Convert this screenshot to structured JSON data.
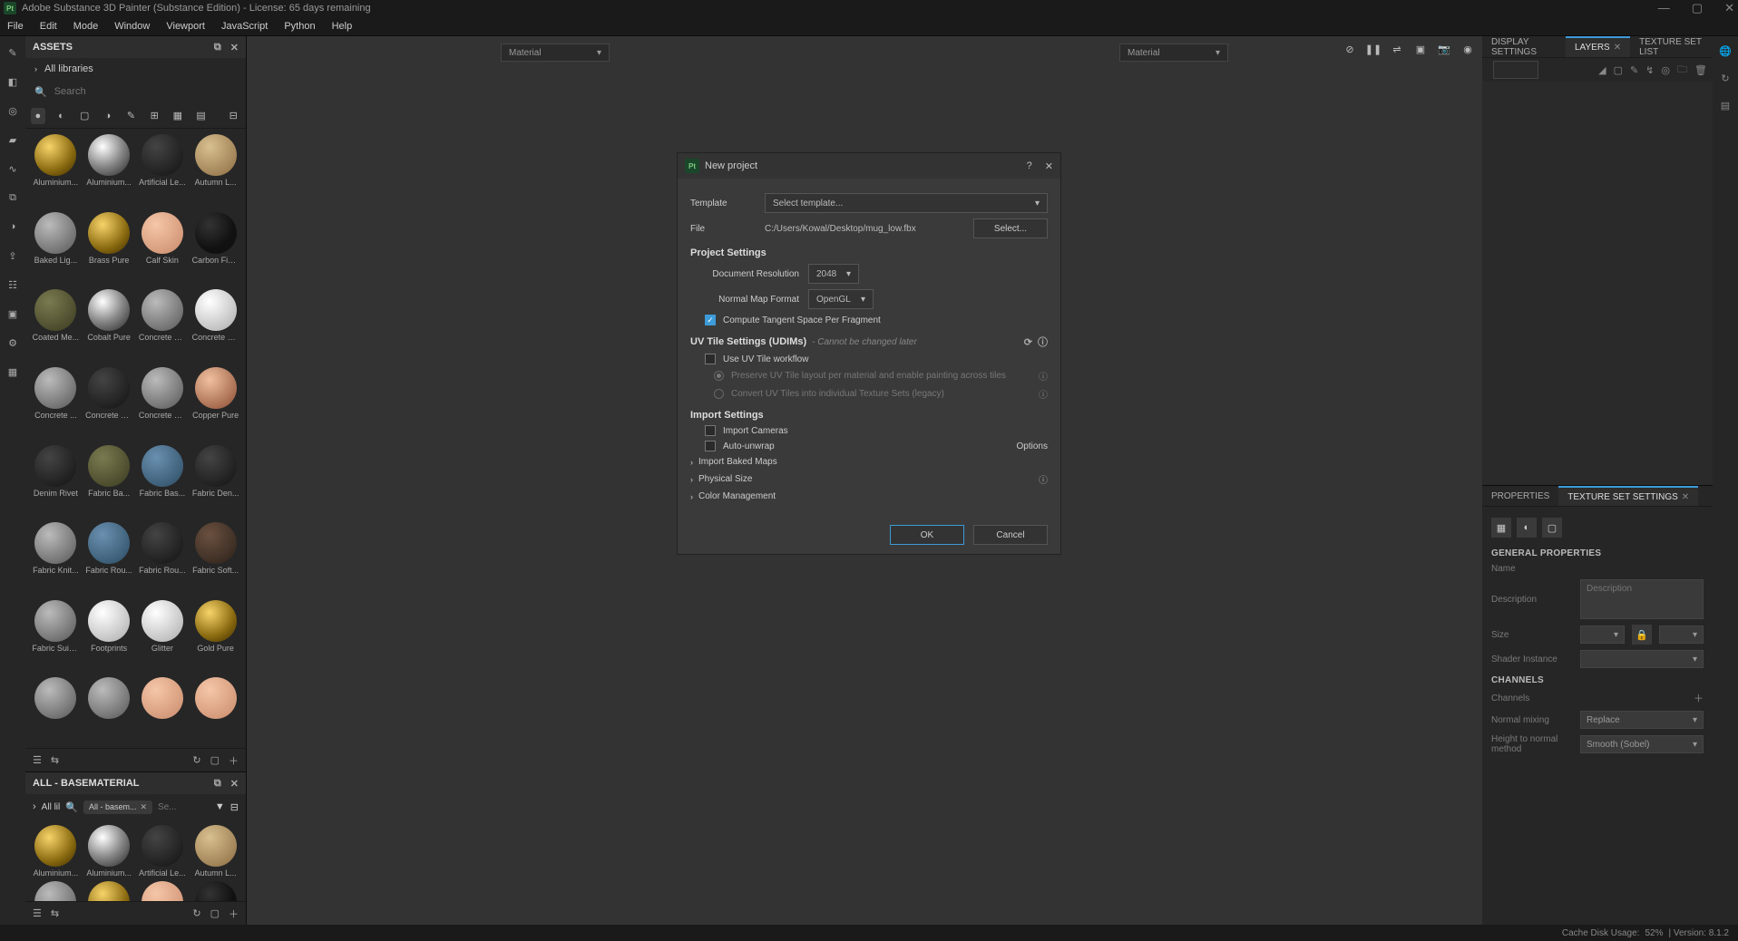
{
  "titlebar": {
    "text": "Adobe Substance 3D Painter (Substance Edition) - License: 65 days remaining"
  },
  "menu": [
    "File",
    "Edit",
    "Mode",
    "Window",
    "Viewport",
    "JavaScript",
    "Python",
    "Help"
  ],
  "assets": {
    "title": "ASSETS",
    "libs": "All libraries",
    "search_placeholder": "Search",
    "materials": [
      {
        "label": "Aluminium...",
        "cls": "gold"
      },
      {
        "label": "Aluminium...",
        "cls": "chrome"
      },
      {
        "label": "Artificial Le...",
        "cls": "dark"
      },
      {
        "label": "Autumn L...",
        "cls": "leaf"
      },
      {
        "label": "Baked Lig...",
        "cls": "grey"
      },
      {
        "label": "Brass Pure",
        "cls": "gold"
      },
      {
        "label": "Calf Skin",
        "cls": "skin"
      },
      {
        "label": "Carbon Fiber",
        "cls": "carbon"
      },
      {
        "label": "Coated Me...",
        "cls": "olive"
      },
      {
        "label": "Cobalt Pure",
        "cls": "chrome"
      },
      {
        "label": "Concrete B...",
        "cls": "grey"
      },
      {
        "label": "Concrete C...",
        "cls": "white"
      },
      {
        "label": "Concrete ...",
        "cls": "grey"
      },
      {
        "label": "Concrete S...",
        "cls": "dark"
      },
      {
        "label": "Concrete S...",
        "cls": "grey"
      },
      {
        "label": "Copper Pure",
        "cls": "copper"
      },
      {
        "label": "Denim Rivet",
        "cls": "dark"
      },
      {
        "label": "Fabric Ba...",
        "cls": "olive"
      },
      {
        "label": "Fabric Bas...",
        "cls": "blue"
      },
      {
        "label": "Fabric Den...",
        "cls": "dark"
      },
      {
        "label": "Fabric Knit...",
        "cls": "grey"
      },
      {
        "label": "Fabric Rou...",
        "cls": "blue"
      },
      {
        "label": "Fabric Rou...",
        "cls": "dark"
      },
      {
        "label": "Fabric Soft...",
        "cls": "brown"
      },
      {
        "label": "Fabric Suit ...",
        "cls": "grey"
      },
      {
        "label": "Footprints",
        "cls": "white"
      },
      {
        "label": "Glitter",
        "cls": "white"
      },
      {
        "label": "Gold Pure",
        "cls": "gold"
      },
      {
        "label": "",
        "cls": "grey"
      },
      {
        "label": "",
        "cls": "grey"
      },
      {
        "label": "",
        "cls": "skin"
      },
      {
        "label": "",
        "cls": "skin"
      }
    ]
  },
  "subpanel": {
    "title": "ALL - BASEMATERIAL",
    "libs": "All lil",
    "chip": "All - basem...",
    "search_placeholder": "Se...",
    "materials": [
      {
        "label": "Aluminium...",
        "cls": "gold"
      },
      {
        "label": "Aluminium...",
        "cls": "chrome"
      },
      {
        "label": "Artificial Le...",
        "cls": "dark"
      },
      {
        "label": "Autumn L...",
        "cls": "leaf"
      },
      {
        "label": "",
        "cls": "grey"
      },
      {
        "label": "",
        "cls": "gold"
      },
      {
        "label": "",
        "cls": "skin"
      },
      {
        "label": "",
        "cls": "carbon"
      }
    ]
  },
  "viewport": {
    "material": "Material"
  },
  "right": {
    "tabs_top": [
      "DISPLAY SETTINGS",
      "LAYERS",
      "TEXTURE SET LIST"
    ],
    "tabs_top_active": 1,
    "tabs_bottom": [
      "PROPERTIES",
      "TEXTURE SET SETTINGS"
    ],
    "tabs_bottom_active": 1,
    "sections": {
      "general": "GENERAL PROPERTIES",
      "name_lbl": "Name",
      "desc_lbl": "Description",
      "desc_ph": "Description",
      "size_lbl": "Size",
      "shader_lbl": "Shader Instance",
      "channels": "CHANNELS",
      "channels_lbl": "Channels",
      "normal_mix_lbl": "Normal mixing",
      "normal_mix_val": "Replace",
      "h2n_lbl": "Height to normal method",
      "h2n_val": "Smooth (Sobel)"
    }
  },
  "modal": {
    "title": "New project",
    "template_lbl": "Template",
    "template_val": "Select template...",
    "file_lbl": "File",
    "file_val": "C:/Users/Kowal/Desktop/mug_low.fbx",
    "select_btn": "Select...",
    "proj_settings": "Project Settings",
    "docres_lbl": "Document Resolution",
    "docres_val": "2048",
    "nmf_lbl": "Normal Map Format",
    "nmf_val": "OpenGL",
    "compute_tan": "Compute Tangent Space Per Fragment",
    "uv_head": "UV Tile Settings (UDIMs)",
    "uv_hint": "- Cannot be changed later",
    "uv_workflow": "Use UV Tile workflow",
    "uv_opt1": "Preserve UV Tile layout per material and enable painting across tiles",
    "uv_opt2": "Convert UV Tiles into individual Texture Sets (legacy)",
    "import_head": "Import Settings",
    "import_cam": "Import Cameras",
    "auto_unwrap": "Auto-unwrap",
    "options_btn": "Options",
    "baked": "Import Baked Maps",
    "physical": "Physical Size",
    "colorm": "Color Management",
    "ok": "OK",
    "cancel": "Cancel"
  },
  "status": {
    "cache": "Cache Disk Usage:",
    "cache_val": "52%",
    "ver": "| Version: 8.1.2"
  }
}
